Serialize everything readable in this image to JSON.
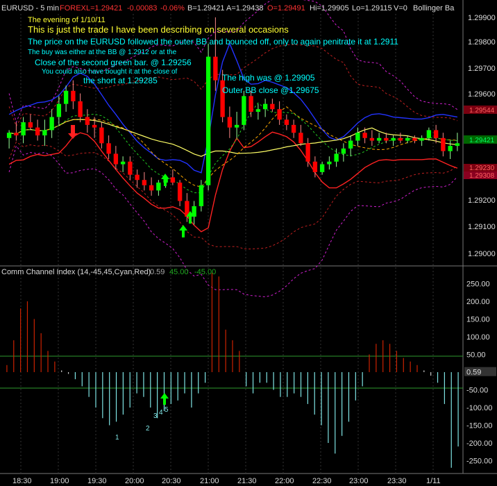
{
  "header": {
    "symbol": "EURUSD - 5 min",
    "market": "FOREX",
    "last": "L=1.29421",
    "change": "-0.00083",
    "change_pct": "-0.06%",
    "bid": "B=1.29421",
    "ask": "A=1.29438",
    "open": "O=1.29491",
    "high": "Hi=1.29905",
    "low": "Lo=1.29115",
    "volume": "V=0",
    "study": "Bollinger Ba"
  },
  "annotations": {
    "line1": "The evening of 1/10/11",
    "line2": "This is just the trade I have been describing on several occasions",
    "line3": "The price on the EURUSD followed the outer BB and bounced off, only to again penitrate it at 1.2911",
    "line4": "The buy was either at the BB @ 1.2912 or at the",
    "line5": "Close of the second green bar. @ 1.29256",
    "line6": "You could also have bought it at the close of",
    "line7": "the short at 1.29285",
    "line8": "The high was @ 1.29905",
    "line9": "Outer BB close @1.29675"
  },
  "price_axis": {
    "ticks": [
      "1.29900",
      "1.29800",
      "1.29700",
      "1.29600",
      "1.29200",
      "1.29100",
      "1.29000"
    ],
    "badges": [
      "1.29544",
      "1.29421",
      "1.29230",
      "1.29308"
    ]
  },
  "cci_panel": {
    "title": "Comm Channel Index (14,-45,45,Cyan,Red)",
    "v1": "0.59",
    "v2": "45.00",
    "v3": "-45.00",
    "ticks": [
      "250.00",
      "200.00",
      "150.00",
      "100.00",
      "50.00",
      "0.59",
      "-50.00",
      "-100.00",
      "-150.00",
      "-200.00",
      "-250.00"
    ],
    "markers": [
      "1",
      "2",
      "3",
      "4",
      "5"
    ]
  },
  "time_axis": [
    "18:30",
    "19:00",
    "19:30",
    "20:00",
    "20:30",
    "21:00",
    "21:30",
    "22:00",
    "22:30",
    "23:00",
    "23:30",
    "1/11"
  ],
  "colors": {
    "up": "#00ff00",
    "down": "#ff0000",
    "cci_up": "#cc2200",
    "cci_down": "#7fe5e5",
    "note": "#00ffff",
    "title": "#ffff33"
  },
  "chart_data": [
    {
      "type": "candlestick",
      "title": "EURUSD - 5 min",
      "ylim": [
        1.2896,
        1.2993
      ],
      "x_labels": [
        "18:30",
        "19:00",
        "19:30",
        "20:00",
        "20:30",
        "21:00",
        "21:30",
        "22:00",
        "22:30",
        "23:00",
        "23:30",
        "1/11"
      ],
      "candles": [
        {
          "o": 1.2944,
          "h": 1.2947,
          "l": 1.294,
          "c": 1.2946
        },
        {
          "o": 1.2946,
          "h": 1.295,
          "l": 1.2943,
          "c": 1.2945
        },
        {
          "o": 1.2945,
          "h": 1.2952,
          "l": 1.2942,
          "c": 1.295
        },
        {
          "o": 1.295,
          "h": 1.2953,
          "l": 1.2947,
          "c": 1.2948
        },
        {
          "o": 1.2948,
          "h": 1.2951,
          "l": 1.2943,
          "c": 1.2945
        },
        {
          "o": 1.2945,
          "h": 1.2951,
          "l": 1.2941,
          "c": 1.2947
        },
        {
          "o": 1.2947,
          "h": 1.2955,
          "l": 1.2944,
          "c": 1.2952
        },
        {
          "o": 1.2952,
          "h": 1.296,
          "l": 1.2949,
          "c": 1.2957
        },
        {
          "o": 1.2957,
          "h": 1.2964,
          "l": 1.2954,
          "c": 1.2962
        },
        {
          "o": 1.2962,
          "h": 1.2966,
          "l": 1.2955,
          "c": 1.2958
        },
        {
          "o": 1.2958,
          "h": 1.2961,
          "l": 1.295,
          "c": 1.2952
        },
        {
          "o": 1.2952,
          "h": 1.2955,
          "l": 1.2946,
          "c": 1.2949
        },
        {
          "o": 1.2949,
          "h": 1.2952,
          "l": 1.2944,
          "c": 1.2948
        },
        {
          "o": 1.2948,
          "h": 1.295,
          "l": 1.294,
          "c": 1.2942
        },
        {
          "o": 1.2942,
          "h": 1.2945,
          "l": 1.2936,
          "c": 1.2938
        },
        {
          "o": 1.2938,
          "h": 1.2941,
          "l": 1.2932,
          "c": 1.2934
        },
        {
          "o": 1.2934,
          "h": 1.2937,
          "l": 1.2931,
          "c": 1.2935
        },
        {
          "o": 1.2935,
          "h": 1.2937,
          "l": 1.2928,
          "c": 1.293
        },
        {
          "o": 1.293,
          "h": 1.2932,
          "l": 1.2925,
          "c": 1.2928
        },
        {
          "o": 1.2928,
          "h": 1.2931,
          "l": 1.2924,
          "c": 1.2926
        },
        {
          "o": 1.2926,
          "h": 1.2929,
          "l": 1.2922,
          "c": 1.2924
        },
        {
          "o": 1.2924,
          "h": 1.2928,
          "l": 1.2922,
          "c": 1.2927
        },
        {
          "o": 1.2927,
          "h": 1.293,
          "l": 1.2925,
          "c": 1.2929
        },
        {
          "o": 1.2929,
          "h": 1.2932,
          "l": 1.2926,
          "c": 1.2927
        },
        {
          "o": 1.2927,
          "h": 1.2928,
          "l": 1.2918,
          "c": 1.292
        },
        {
          "o": 1.292,
          "h": 1.2923,
          "l": 1.2912,
          "c": 1.2914
        },
        {
          "o": 1.2914,
          "h": 1.292,
          "l": 1.2911,
          "c": 1.2918
        },
        {
          "o": 1.2918,
          "h": 1.2928,
          "l": 1.2916,
          "c": 1.2926
        },
        {
          "o": 1.2926,
          "h": 1.298,
          "l": 1.2924,
          "c": 1.2975
        },
        {
          "o": 1.2975,
          "h": 1.299,
          "l": 1.2962,
          "c": 1.2966
        },
        {
          "o": 1.2966,
          "h": 1.297,
          "l": 1.295,
          "c": 1.2952
        },
        {
          "o": 1.2952,
          "h": 1.2956,
          "l": 1.2944,
          "c": 1.2948
        },
        {
          "o": 1.2948,
          "h": 1.2954,
          "l": 1.2944,
          "c": 1.2949
        },
        {
          "o": 1.2949,
          "h": 1.2962,
          "l": 1.2947,
          "c": 1.296
        },
        {
          "o": 1.296,
          "h": 1.2962,
          "l": 1.2952,
          "c": 1.2954
        },
        {
          "o": 1.2954,
          "h": 1.2957,
          "l": 1.2951,
          "c": 1.2955
        },
        {
          "o": 1.2955,
          "h": 1.2959,
          "l": 1.2952,
          "c": 1.2957
        },
        {
          "o": 1.2957,
          "h": 1.2959,
          "l": 1.2954,
          "c": 1.2955
        },
        {
          "o": 1.2955,
          "h": 1.2958,
          "l": 1.2949,
          "c": 1.2951
        },
        {
          "o": 1.2951,
          "h": 1.2953,
          "l": 1.2947,
          "c": 1.2949
        },
        {
          "o": 1.2949,
          "h": 1.2951,
          "l": 1.2944,
          "c": 1.2946
        },
        {
          "o": 1.2946,
          "h": 1.2949,
          "l": 1.2941,
          "c": 1.2942
        },
        {
          "o": 1.2942,
          "h": 1.2944,
          "l": 1.2933,
          "c": 1.2935
        },
        {
          "o": 1.2935,
          "h": 1.2937,
          "l": 1.2929,
          "c": 1.2931
        },
        {
          "o": 1.2931,
          "h": 1.2935,
          "l": 1.293,
          "c": 1.2934
        },
        {
          "o": 1.2934,
          "h": 1.2937,
          "l": 1.2932,
          "c": 1.2935
        },
        {
          "o": 1.2935,
          "h": 1.294,
          "l": 1.2933,
          "c": 1.2938
        },
        {
          "o": 1.2938,
          "h": 1.2942,
          "l": 1.2935,
          "c": 1.294
        },
        {
          "o": 1.294,
          "h": 1.2945,
          "l": 1.2937,
          "c": 1.2943
        },
        {
          "o": 1.2943,
          "h": 1.2948,
          "l": 1.2941,
          "c": 1.2946
        },
        {
          "o": 1.2946,
          "h": 1.2948,
          "l": 1.2942,
          "c": 1.2944
        },
        {
          "o": 1.2944,
          "h": 1.2947,
          "l": 1.2941,
          "c": 1.2943
        },
        {
          "o": 1.2943,
          "h": 1.2946,
          "l": 1.2942,
          "c": 1.2944
        },
        {
          "o": 1.2944,
          "h": 1.2946,
          "l": 1.2942,
          "c": 1.2943
        },
        {
          "o": 1.2943,
          "h": 1.2945,
          "l": 1.2941,
          "c": 1.2944
        },
        {
          "o": 1.2944,
          "h": 1.2946,
          "l": 1.2942,
          "c": 1.2943
        },
        {
          "o": 1.2943,
          "h": 1.2945,
          "l": 1.2942,
          "c": 1.2944
        },
        {
          "o": 1.2944,
          "h": 1.2945,
          "l": 1.2942,
          "c": 1.2943
        },
        {
          "o": 1.2943,
          "h": 1.2945,
          "l": 1.2941,
          "c": 1.2944
        },
        {
          "o": 1.2944,
          "h": 1.2948,
          "l": 1.2943,
          "c": 1.2947
        },
        {
          "o": 1.2947,
          "h": 1.2949,
          "l": 1.2942,
          "c": 1.2944
        },
        {
          "o": 1.2944,
          "h": 1.2946,
          "l": 1.2937,
          "c": 1.2939
        },
        {
          "o": 1.2939,
          "h": 1.2943,
          "l": 1.2936,
          "c": 1.2941
        },
        {
          "o": 1.2941,
          "h": 1.2946,
          "l": 1.2939,
          "c": 1.2942
        }
      ]
    },
    {
      "type": "bar",
      "title": "Comm Channel Index (14,-45,45,Cyan,Red)",
      "ylim": [
        -275,
        275
      ],
      "thresholds": [
        45,
        -45
      ],
      "values": [
        20,
        90,
        180,
        200,
        150,
        110,
        60,
        30,
        5,
        -5,
        -20,
        -40,
        -70,
        -100,
        -130,
        -150,
        -140,
        -120,
        -100,
        -60,
        -70,
        -100,
        -130,
        -110,
        -90,
        -80,
        -60,
        -100,
        -60,
        -30,
        280,
        270,
        120,
        90,
        60,
        -40,
        -60,
        -30,
        -30,
        -50,
        -70,
        -70,
        -60,
        -70,
        -90,
        -120,
        -150,
        -200,
        -230,
        -180,
        -140,
        -80,
        -40,
        50,
        80,
        90,
        80,
        60,
        40,
        30,
        20,
        5,
        -10,
        -30,
        -90,
        -270,
        -210
      ]
    }
  ]
}
